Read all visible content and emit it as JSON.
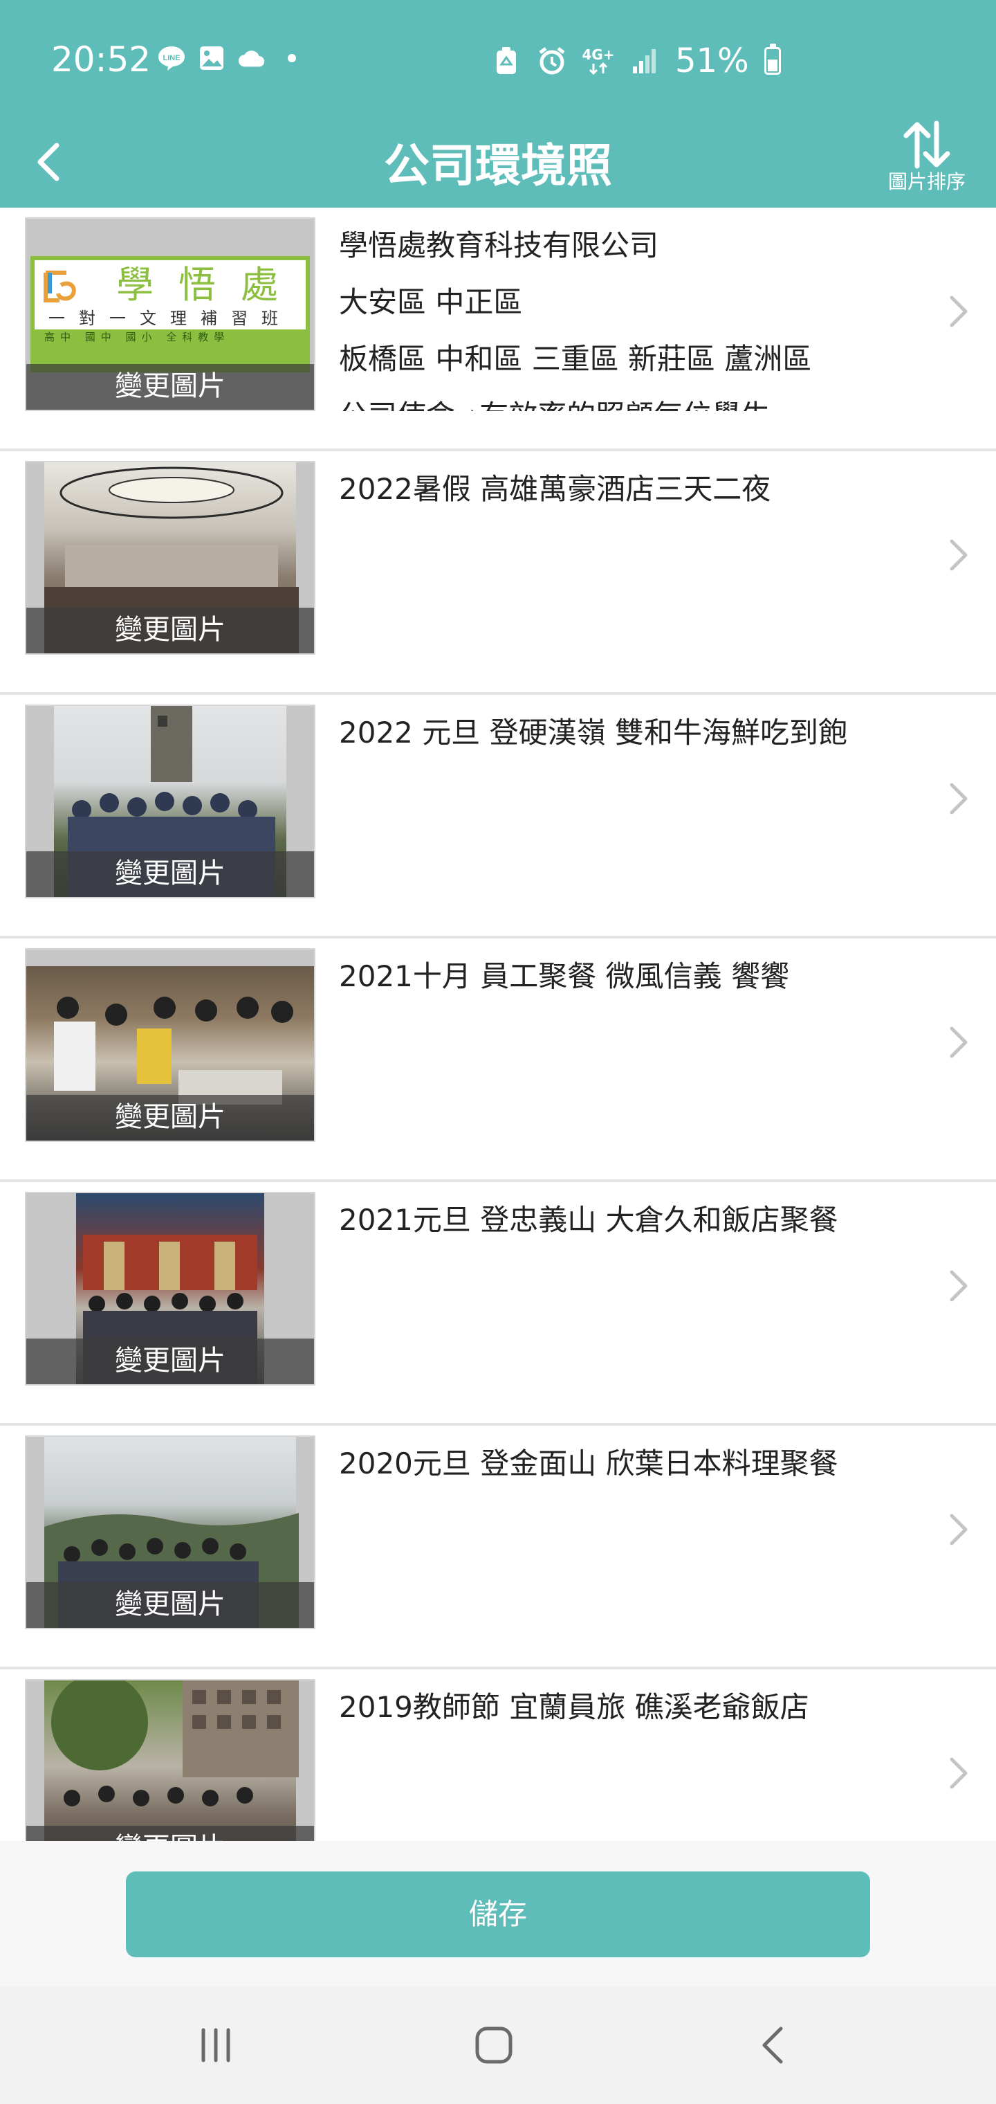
{
  "status_bar": {
    "time": "20:52",
    "left_icons": [
      "line-icon",
      "gallery-icon",
      "cloud-icon",
      "dot-icon"
    ],
    "right_icons": [
      "recycle-icon",
      "alarm-icon",
      "4g-icon",
      "signal-icon"
    ],
    "network_label": "4G+",
    "battery_percent": "51%",
    "battery_level": 0.51
  },
  "header": {
    "title": "公司環境照",
    "sort_label": "圖片排序",
    "background_color": "#5fbdb9"
  },
  "rows": [
    {
      "lines": [
        "學悟處教育科技有限公司",
        "大安區 中正區",
        "板橋區 中和區 三重區 新莊區 蘆洲區",
        "公司使命➡有效率的照顧每位學生"
      ],
      "change_label": "變更圖片",
      "logo": {
        "brand": "學悟處",
        "tagline": "一對一文理補習班",
        "footer": "高中 國中 國小 全科教學"
      }
    },
    {
      "lines": [
        "2022暑假 高雄萬豪酒店三天二夜"
      ],
      "change_label": "變更圖片"
    },
    {
      "lines": [
        "2022 元旦 登硬漢嶺 雙和牛海鮮吃到飽"
      ],
      "change_label": "變更圖片"
    },
    {
      "lines": [
        "2021十月 員工聚餐 微風信義 饗饗"
      ],
      "change_label": "變更圖片"
    },
    {
      "lines": [
        "2021元旦 登忠義山 大倉久和飯店聚餐"
      ],
      "change_label": "變更圖片"
    },
    {
      "lines": [
        "2020元旦 登金面山 欣葉日本料理聚餐"
      ],
      "change_label": "變更圖片"
    },
    {
      "lines": [
        "2019教師節 宜蘭員旅 礁溪老爺飯店"
      ],
      "change_label": "變更圖片"
    }
  ],
  "save_button": {
    "label": "儲存"
  },
  "nav_bar": {
    "buttons": [
      "recent-apps-icon",
      "home-icon",
      "back-icon"
    ]
  },
  "colors": {
    "accent": "#5fbdb9",
    "overlay": "#3c3c3c",
    "divider": "#e4e4e4",
    "logo_green": "#8cbf3f"
  }
}
